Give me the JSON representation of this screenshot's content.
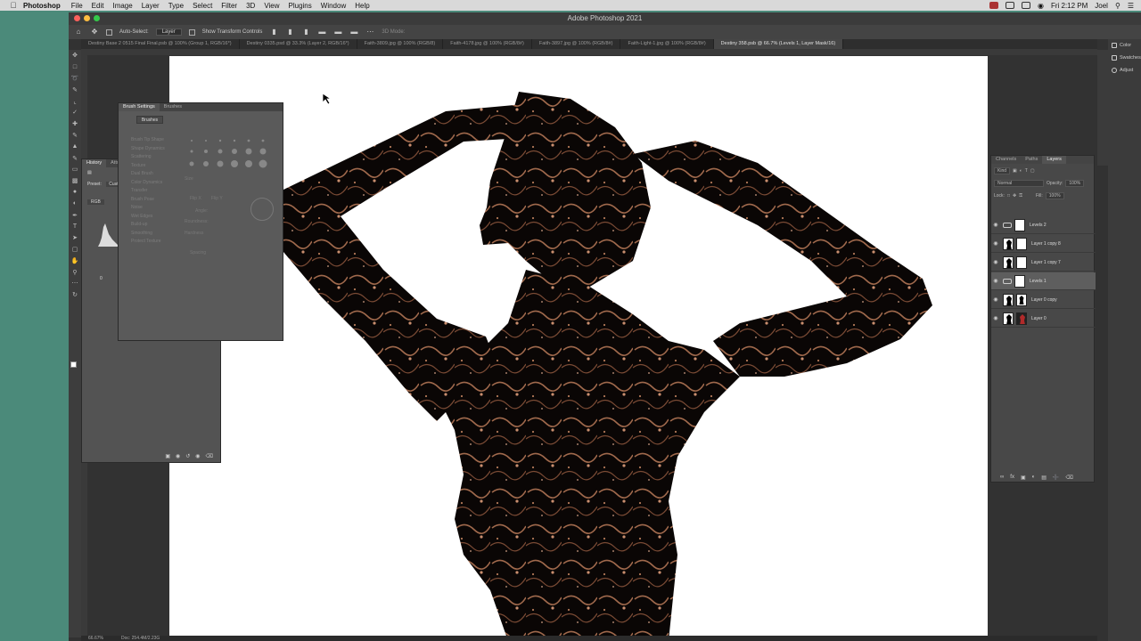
{
  "menubar": {
    "app_name": "Photoshop",
    "menus": [
      "File",
      "Edit",
      "Image",
      "Layer",
      "Type",
      "Select",
      "Filter",
      "3D",
      "View",
      "Plugins",
      "Window",
      "Help"
    ],
    "clock": "Fri 2:12 PM",
    "user": "Joel"
  },
  "window": {
    "title": "Adobe Photoshop 2021"
  },
  "options_bar": {
    "auto_select_label": "Auto-Select:",
    "auto_select_value": "Layer",
    "show_transform_label": "Show Transform Controls",
    "mode_label": "3D Mode:"
  },
  "doc_tabs": [
    "Destiny Base 2 0515 Final Final.psb @ 100% (Group 1, RGB/16*)",
    "Destiny 0335.psd @ 33.3% (Layer 2, RGB/16*)",
    "Faith-3809.jpg @ 100% (RGB/8)",
    "Faith-4178.jpg @ 100% (RGB/8#)",
    "Faith-3897.jpg @ 100% (RGB/8#)",
    "Faith-Light-1.jpg @ 100% (RGB/8#)",
    "Destiny 358.psb @ 66.7% (Levels 1, Layer Mask/16)"
  ],
  "active_tab_index": 6,
  "history_panel": {
    "tabs": [
      "History",
      "Attr"
    ],
    "preset_label": "Preset:",
    "preset_value": "Custom",
    "channel": "RGB",
    "value": "0"
  },
  "brush_settings": {
    "tabs": [
      "Brush Settings",
      "Brushes"
    ],
    "brushes_button": "Brushes",
    "options": [
      "Brush Tip Shape",
      "Shape Dynamics",
      "Scattering",
      "Texture",
      "Dual Brush",
      "Color Dynamics",
      "Transfer",
      "Brush Pose",
      "Noise",
      "Wet Edges",
      "Build-up",
      "Smoothing",
      "Protect Texture"
    ],
    "size_label": "Size",
    "flip_x": "Flip X",
    "flip_y": "Flip Y",
    "angle_label": "Angle:",
    "roundness_label": "Roundness:",
    "hardness_label": "Hardness",
    "spacing_label": "Spacing"
  },
  "layers_panel": {
    "tabs": [
      "Channels",
      "Paths",
      "Layers"
    ],
    "kind_label": "Kind",
    "blend_mode": "Normal",
    "opacity_label": "Opacity:",
    "opacity_value": "100%",
    "lock_label": "Lock:",
    "fill_label": "Fill:",
    "fill_value": "100%",
    "layers": [
      {
        "name": "Levels 2",
        "type": "adjustment",
        "selected": false
      },
      {
        "name": "Layer 1 copy 8",
        "type": "pixel",
        "selected": false
      },
      {
        "name": "Layer 1 copy 7",
        "type": "pixel",
        "selected": false
      },
      {
        "name": "Levels 1",
        "type": "adjustment",
        "selected": true
      },
      {
        "name": "Layer 0 copy",
        "type": "pixel",
        "selected": false
      },
      {
        "name": "Layer 0",
        "type": "pixel",
        "selected": false
      }
    ]
  },
  "right_dock": {
    "items": [
      "Color",
      "Swatches",
      "Adjust"
    ]
  },
  "statusbar": {
    "zoom": "66.67%",
    "doc": "Doc: 254.4M/2.23G"
  },
  "colors": {
    "accent_teal": "#4b8a7a",
    "ps_dark": "#323232",
    "panel": "#535353"
  }
}
